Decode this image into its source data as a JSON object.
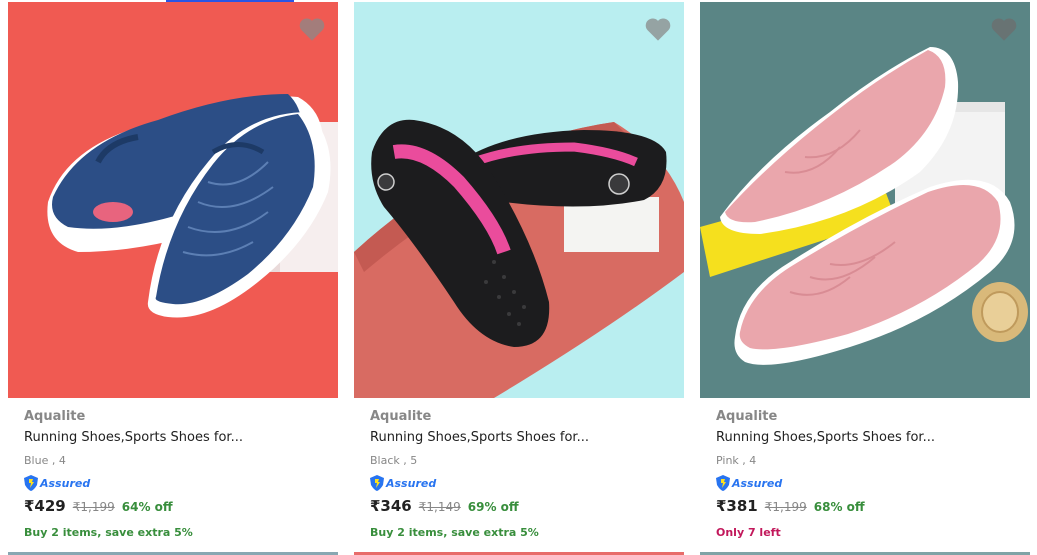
{
  "products": [
    {
      "brand": "Aqualite",
      "title": "Running Shoes,Sports Shoes for...",
      "variant": "Blue , 4",
      "assured_label": "Assured",
      "price": "₹429",
      "mrp": "₹1,199",
      "discount": "64% off",
      "offer": "Buy 2 items, save extra 5%",
      "offer_color": "#388e3c",
      "image_bg": "#f05a52",
      "shoe_color": "#2c4e86",
      "bottom_color": "#88a7b2"
    },
    {
      "brand": "Aqualite",
      "title": "Running Shoes,Sports Shoes for...",
      "variant": "Black , 5",
      "assured_label": "Assured",
      "price": "₹346",
      "mrp": "₹1,149",
      "discount": "69% off",
      "offer": "Buy 2 items, save extra 5%",
      "offer_color": "#388e3c",
      "image_bg": "#b9eef0",
      "shoe_color": "#1c1c1e",
      "bottom_color": "#e86c6a"
    },
    {
      "brand": "Aqualite",
      "title": "Running Shoes,Sports Shoes for...",
      "variant": "Pink , 4",
      "assured_label": "Assured",
      "price": "₹381",
      "mrp": "₹1,199",
      "discount": "68% off",
      "offer": "Only 7 left",
      "offer_color": "#c2185b",
      "image_bg": "#5a8585",
      "shoe_color": "#eaa6ac",
      "bottom_color": "#7fa3a6"
    }
  ],
  "colors": {
    "brand_text": "#878787",
    "title_text": "#212121",
    "discount_green": "#388e3c",
    "assured_blue": "#2874f0",
    "wishlist_heart": "#8a8a8a"
  },
  "icons": {
    "wishlist": "heart-icon",
    "assured": "assured-shield-icon"
  }
}
